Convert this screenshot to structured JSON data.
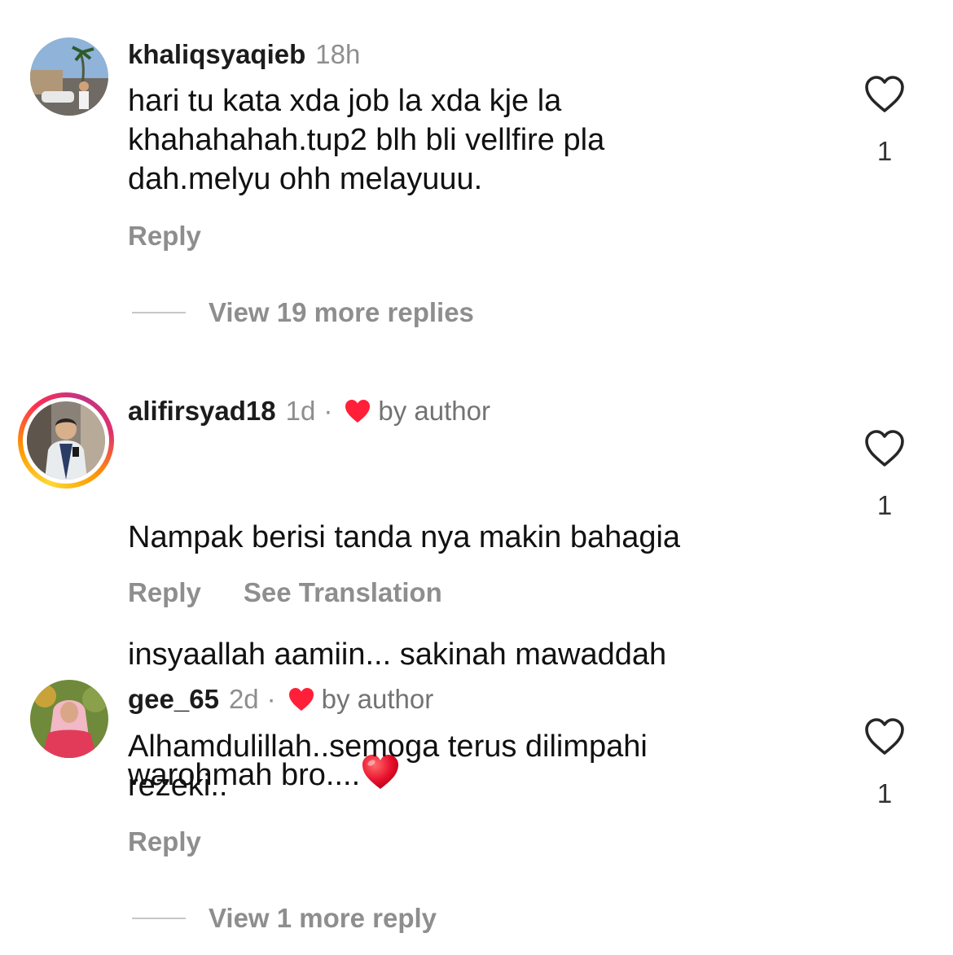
{
  "colors": {
    "like_heart_author": "#ff1f38",
    "muted_text": "#8e8e8e",
    "story_ring": [
      "#fdd835",
      "#ff9800",
      "#ff2d55",
      "#c13584"
    ]
  },
  "comments": [
    {
      "username": "khaliqsyaqieb",
      "time": "18h",
      "liked_by_author": false,
      "text": "hari tu kata xda job la xda kje la\nkhahahahah.tup2 blh bli vellfire pla\ndah.melyu ohh melayuuu.",
      "reply_label": "Reply",
      "like_count": "1",
      "avatar_icon": "avatar-photo",
      "view_more": "View 19 more replies"
    },
    {
      "username": "alifirsyad18",
      "time": "1d",
      "separator": "·",
      "liked_by_author": true,
      "by_author": "by author",
      "text_line1": "Nampak berisi tanda nya makin bahagia",
      "text_line2": "insyaallah aamiin... sakinah mawaddah",
      "text_line3": "warohmah bro....",
      "emoji": "red-heart-emoji",
      "reply_label": "Reply",
      "translate_label": "See Translation",
      "like_count": "1",
      "avatar_icon": "avatar-photo",
      "has_story_ring": true
    },
    {
      "username": "gee_65",
      "time": "2d",
      "separator": "·",
      "liked_by_author": true,
      "by_author": "by author",
      "text": "Alhamdulillah..semoga terus dilimpahi\nrezeki..",
      "reply_label": "Reply",
      "like_count": "1",
      "avatar_icon": "avatar-photo",
      "view_more": "View 1 more reply"
    }
  ]
}
